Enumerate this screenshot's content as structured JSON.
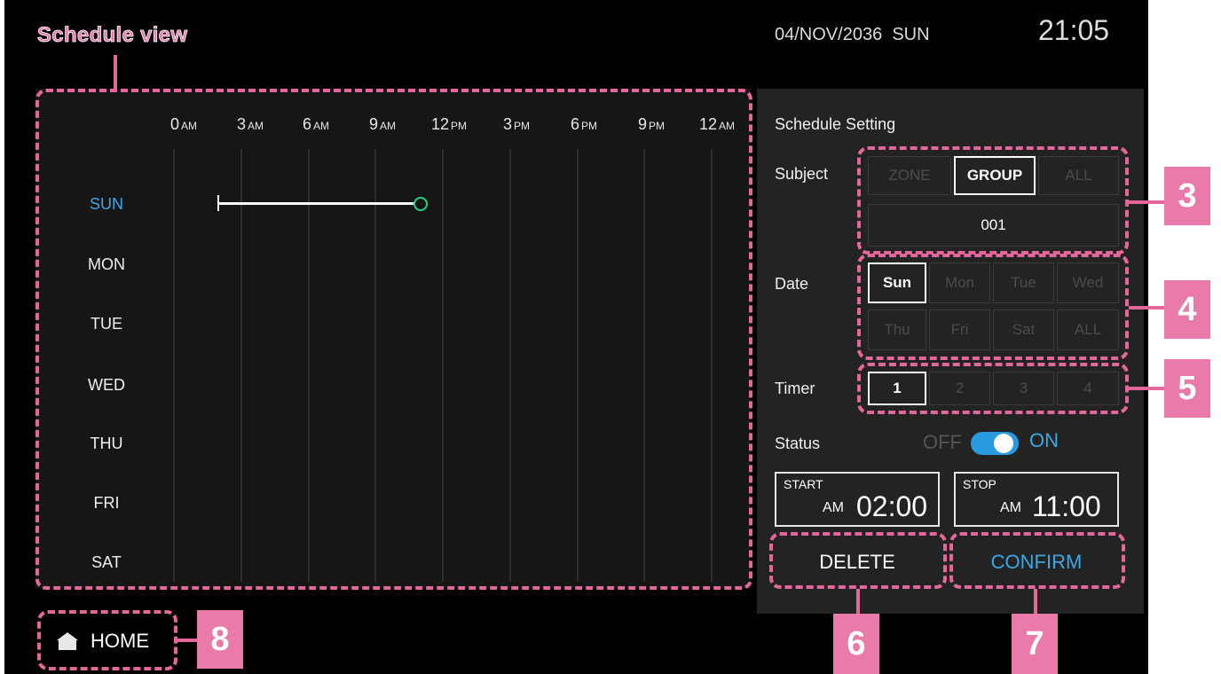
{
  "annotation": {
    "view_label": "Schedule view",
    "badges": [
      "3",
      "4",
      "5",
      "6",
      "7",
      "8"
    ]
  },
  "header": {
    "date": "04/NOV/2036",
    "weekday": "SUN",
    "time": "21:05"
  },
  "schedule_view": {
    "hours": [
      {
        "num": "0",
        "ap": "AM"
      },
      {
        "num": "3",
        "ap": "AM"
      },
      {
        "num": "6",
        "ap": "AM"
      },
      {
        "num": "9",
        "ap": "AM"
      },
      {
        "num": "12",
        "ap": "PM"
      },
      {
        "num": "3",
        "ap": "PM"
      },
      {
        "num": "6",
        "ap": "PM"
      },
      {
        "num": "9",
        "ap": "PM"
      },
      {
        "num": "12",
        "ap": "AM"
      }
    ],
    "days": [
      "SUN",
      "MON",
      "TUE",
      "WED",
      "THU",
      "FRI",
      "SAT"
    ],
    "active_day": "SUN",
    "active_color": "#3aa8e6",
    "entries": [
      {
        "day": "SUN",
        "start": "02:00",
        "stop": "11:00",
        "end_marker_color": "#29d088"
      }
    ]
  },
  "settings": {
    "title": "Schedule Setting",
    "subject": {
      "label": "Subject",
      "options": [
        "ZONE",
        "GROUP",
        "ALL"
      ],
      "selected": "GROUP",
      "value": "001"
    },
    "date": {
      "label": "Date",
      "options": [
        "Sun",
        "Mon",
        "Tue",
        "Wed",
        "Thu",
        "Fri",
        "Sat",
        "ALL"
      ],
      "selected": "Sun"
    },
    "timer": {
      "label": "Timer",
      "options": [
        "1",
        "2",
        "3",
        "4"
      ],
      "selected": "1"
    },
    "status": {
      "label": "Status",
      "off_label": "OFF",
      "on_label": "ON",
      "value": "ON",
      "toggle_color": "#2a9be0"
    },
    "start": {
      "caption": "START",
      "meridian": "AM",
      "time": "02:00"
    },
    "stop": {
      "caption": "STOP",
      "meridian": "AM",
      "time": "11:00"
    }
  },
  "actions": {
    "delete_label": "DELETE",
    "confirm_label": "CONFIRM",
    "confirm_color": "#3aa8e6"
  },
  "footer": {
    "home_label": "HOME",
    "home_icon": "home-icon"
  },
  "colors": {
    "annotation_pink": "#e4679a",
    "badge_pink": "#ea7aa9"
  }
}
